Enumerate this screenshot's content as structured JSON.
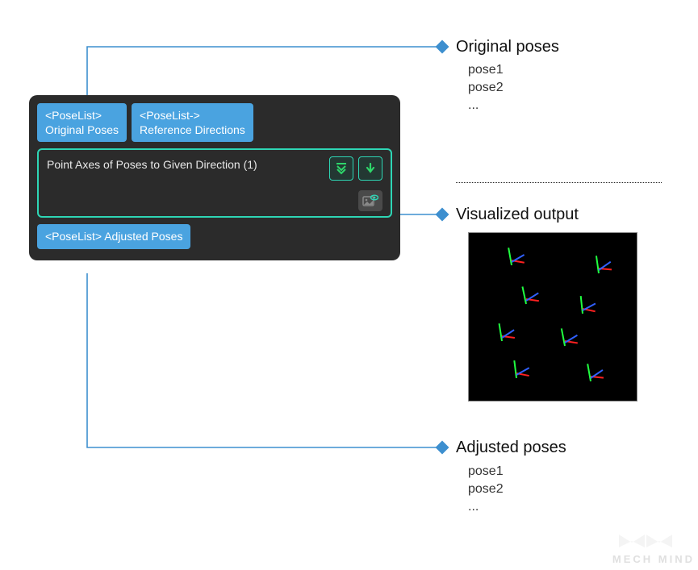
{
  "tabs": {
    "in1": {
      "line1": "<PoseList>",
      "line2": "Original Poses"
    },
    "in2": {
      "line1": "<PoseList->",
      "line2": "Reference Directions"
    },
    "out": {
      "line1": "<PoseList>",
      "line2": "Adjusted Poses"
    }
  },
  "main_title": "Point Axes of Poses to Given Direction (1)",
  "callouts": {
    "original": {
      "title": "Original poses",
      "items": [
        "pose1",
        "pose2",
        "..."
      ]
    },
    "visualized": {
      "title": "Visualized output"
    },
    "adjusted": {
      "title": "Adjusted poses",
      "items": [
        "pose1",
        "pose2",
        "..."
      ]
    }
  },
  "watermark": "MECH MIND"
}
